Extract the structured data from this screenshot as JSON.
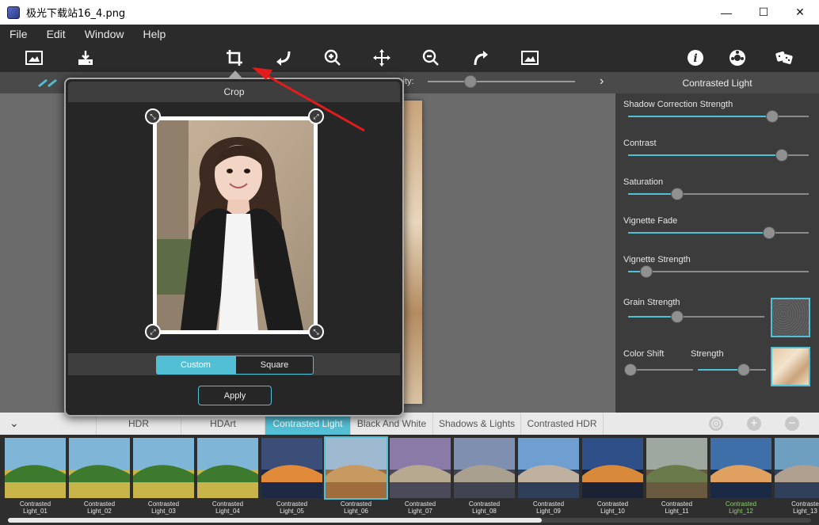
{
  "window": {
    "title": "极光下载站16_4.png",
    "minimize": "—",
    "maximize": "☐",
    "close": "✕"
  },
  "menu": [
    "File",
    "Edit",
    "Window",
    "Help"
  ],
  "toolbar": {
    "icons": [
      "open-image-icon",
      "save-icon",
      "crop-icon",
      "undo-icon",
      "zoom-in-icon",
      "pan-icon",
      "zoom-out-icon",
      "redo-icon",
      "fit-image-icon",
      "info-icon",
      "settings-icon",
      "random-dice-icon"
    ]
  },
  "subbar": {
    "opacity_label": "city:",
    "opacity_value": 0.29
  },
  "crop_popup": {
    "title": "Crop",
    "mode_custom": "Custom",
    "mode_square": "Square",
    "apply": "Apply"
  },
  "right_panel": {
    "title": "Contrasted Light",
    "sliders": [
      {
        "label": "Shadow Correction Strength",
        "value": 0.8
      },
      {
        "label": "Contrast",
        "value": 0.85
      },
      {
        "label": "Saturation",
        "value": 0.27
      },
      {
        "label": "Vignette Fade",
        "value": 0.78
      },
      {
        "label": "Vignette Strength",
        "value": 0.1
      },
      {
        "label": "Grain Strength",
        "value": 0.36
      }
    ],
    "color_shift": {
      "label": "Color Shift",
      "value": 0.0
    },
    "strength": {
      "label": "Strength",
      "value": 0.68
    },
    "colors": {
      "accent": "#4fc1d6"
    }
  },
  "categories": [
    "HDR",
    "HDArt",
    "Contrasted Light",
    "Black And White",
    "Shadows & Lights",
    "Contrasted HDR"
  ],
  "active_category": "Contrasted Light",
  "thumbnails": [
    {
      "label": "Contrasted\nLight_01"
    },
    {
      "label": "Contrasted\nLight_02"
    },
    {
      "label": "Contrasted\nLight_03"
    },
    {
      "label": "Contrasted\nLight_04"
    },
    {
      "label": "Contrasted\nLight_05"
    },
    {
      "label": "Contrasted\nLight_06"
    },
    {
      "label": "Contrasted\nLight_07"
    },
    {
      "label": "Contrasted\nLight_08"
    },
    {
      "label": "Contrasted\nLight_09"
    },
    {
      "label": "Contrasted\nLight_10"
    },
    {
      "label": "Contrasted\nLight_11"
    },
    {
      "label": "Contrasted\nLight_12"
    },
    {
      "label": "Contraste\nLight_13"
    }
  ]
}
